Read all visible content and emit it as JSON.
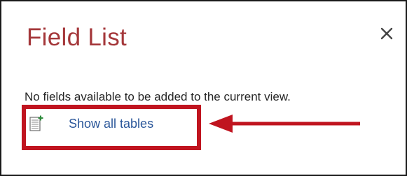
{
  "pane": {
    "title": "Field List",
    "message": "No fields available to be added to the current view."
  },
  "actions": {
    "show_all_tables_label": "Show all tables",
    "show_all_tables_icon": "add-table-icon",
    "close_icon": "close-icon"
  },
  "annotation": {
    "highlight_color": "#c0141f",
    "arrow_icon": "left-arrow-annotation"
  },
  "colors": {
    "title": "#a4373a",
    "link": "#2b579a",
    "text": "#262626"
  }
}
